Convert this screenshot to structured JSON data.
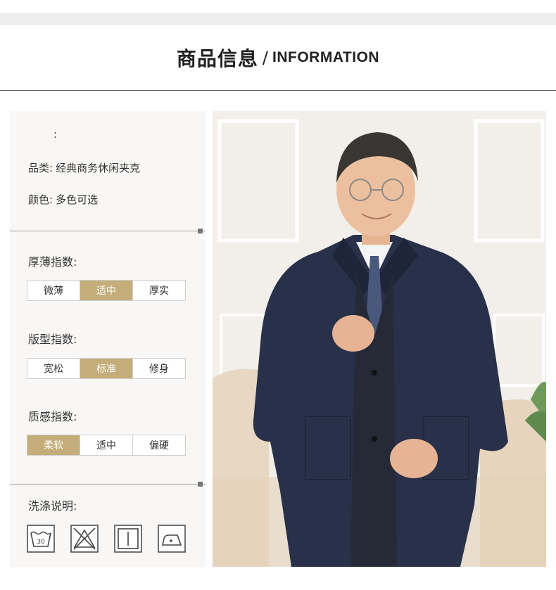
{
  "header": {
    "title_cn": "商品信息",
    "separator": "/",
    "title_en": "INFORMATION"
  },
  "product": {
    "name_label": ":",
    "category_key": "品类:",
    "category_value": "经典商务休闲夹克",
    "color_key": "颜色:",
    "color_value": "多色可选"
  },
  "scales": [
    {
      "title": "厚薄指数:",
      "options": [
        "微薄",
        "适中",
        "厚实"
      ],
      "selected": 1
    },
    {
      "title": "版型指数:",
      "options": [
        "宽松",
        "标准",
        "修身"
      ],
      "selected": 1
    },
    {
      "title": "质感指数:",
      "options": [
        "柔软",
        "适中",
        "偏硬"
      ],
      "selected": 0
    }
  ],
  "care": {
    "title": "洗涤说明:",
    "icons": [
      {
        "name": "wash-30-icon",
        "text": "30"
      },
      {
        "name": "do-not-bleach-icon",
        "text": ""
      },
      {
        "name": "line-dry-icon",
        "text": ""
      },
      {
        "name": "iron-low-icon",
        "text": ""
      }
    ]
  },
  "accent_color": "#c5ad7a"
}
